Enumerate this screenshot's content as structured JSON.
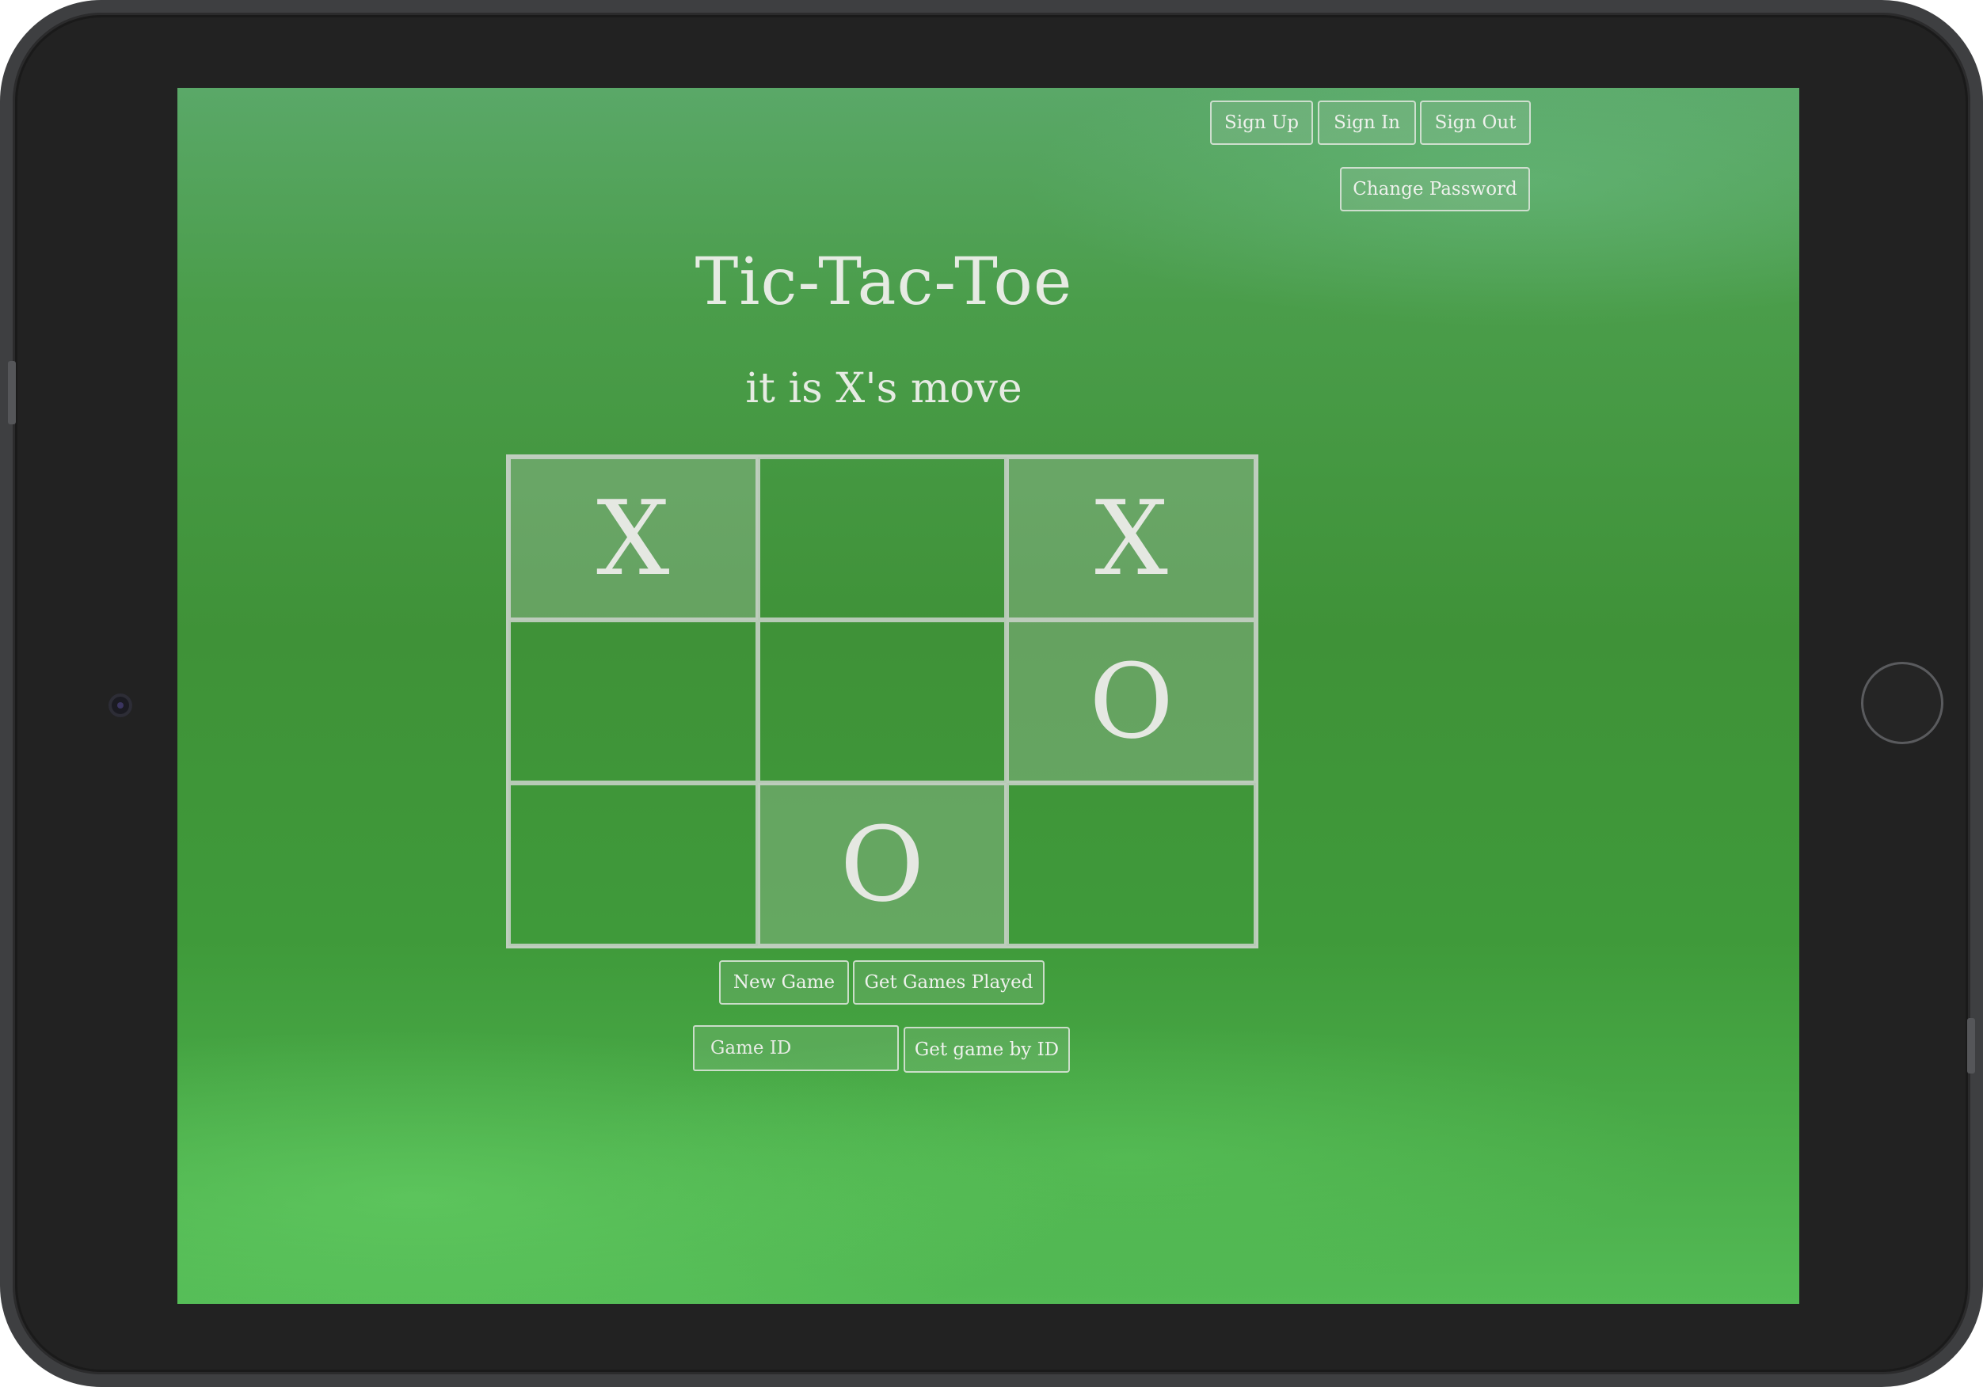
{
  "auth": {
    "sign_up": "Sign Up",
    "sign_in": "Sign In",
    "sign_out": "Sign Out",
    "change_password": "Change Password"
  },
  "game": {
    "title": "Tic-Tac-Toe",
    "turn_message": "it is X's move",
    "board": [
      [
        "X",
        "",
        "X"
      ],
      [
        "",
        "",
        "O"
      ],
      [
        "",
        "O",
        ""
      ]
    ]
  },
  "controls": {
    "new_game": "New Game",
    "get_games_played": "Get Games Played",
    "game_id_placeholder": "Game ID",
    "get_game_by_id": "Get game by ID"
  },
  "colors": {
    "background": "#3f9238",
    "text": "#e6ebe3",
    "device_frame": "#222222"
  }
}
